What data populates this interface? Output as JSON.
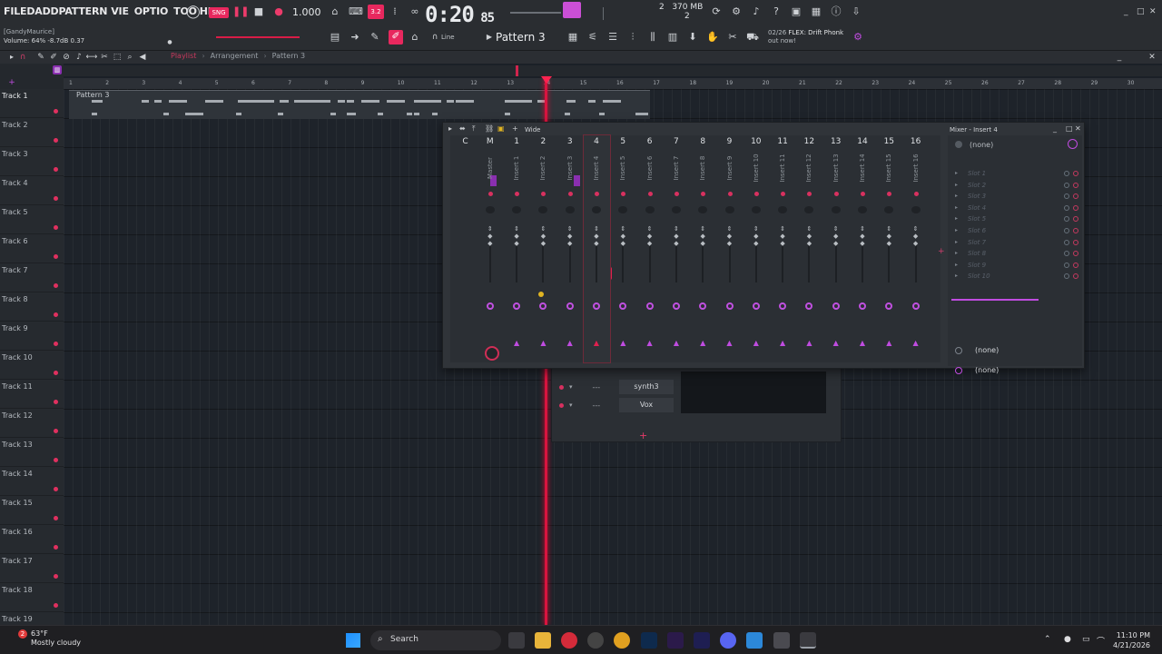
{
  "menu": [
    "FILE",
    "EDIT",
    "ADD",
    "PATTERNS",
    "VIEW",
    "OPTIONS",
    "TOOLS",
    "HELP"
  ],
  "menu_visible": [
    "FILE",
    "D",
    "ADD",
    "PATTERN",
    "VIE",
    "OPTIO",
    "TOO",
    "HEL"
  ],
  "hint": {
    "user": "[GandyMaurice]",
    "volume": "Volume: 64%  -8.7dB  0.37"
  },
  "transport": {
    "tempo": "1.000",
    "time_main": "0:20",
    "time_sub": "85",
    "pattern": "Pattern 3",
    "snap": "Line"
  },
  "memory": {
    "cpu": "2",
    "mem": "370 MB",
    "voices": "2"
  },
  "news": {
    "date": "02/26",
    "title": "FLEX: Drift Phonk",
    "sub": "out now!"
  },
  "playlist": {
    "breadcrumb": [
      "Playlist",
      "Arrangement",
      "Pattern 3"
    ],
    "clip_label": "Pattern 3",
    "ruler_bars": [
      "1",
      "2",
      "3",
      "4",
      "5",
      "6",
      "7",
      "8",
      "9",
      "10",
      "11",
      "12",
      "13",
      "14",
      "15",
      "16",
      "17",
      "18",
      "19",
      "20",
      "21",
      "22",
      "23",
      "24",
      "25",
      "26",
      "27",
      "28",
      "29",
      "30"
    ],
    "tracks": [
      "Track 1",
      "Track 2",
      "Track 3",
      "Track 4",
      "Track 5",
      "Track 6",
      "Track 7",
      "Track 8",
      "Track 9",
      "Track 10",
      "Track 11",
      "Track 12",
      "Track 13",
      "Track 14",
      "Track 15",
      "Track 16",
      "Track 17",
      "Track 18",
      "Track 19"
    ]
  },
  "channel_rack": {
    "channels": [
      "synth3",
      "Vox"
    ],
    "dash": "---"
  },
  "mixer": {
    "title": "Mixer - Insert 4",
    "view_mode": "Wide",
    "strip_numbers": [
      "C",
      "M",
      "1",
      "2",
      "3",
      "4",
      "5",
      "6",
      "7",
      "8",
      "9",
      "10",
      "11",
      "12",
      "13",
      "14",
      "15",
      "16"
    ],
    "strip_labels": [
      "",
      "Master",
      "Insert 1",
      "Insert 2",
      "Insert 3",
      "Insert 4",
      "Insert 5",
      "Insert 6",
      "Insert 7",
      "Insert 8",
      "Insert 9",
      "Insert 10",
      "Insert 11",
      "Insert 12",
      "Insert 13",
      "Insert 14",
      "Insert 15",
      "Insert 16"
    ],
    "routing": "(none)",
    "slots": [
      "Slot 1",
      "Slot 2",
      "Slot 3",
      "Slot 4",
      "Slot 5",
      "Slot 6",
      "Slot 7",
      "Slot 8",
      "Slot 9",
      "Slot 10"
    ],
    "input_none": "(none)",
    "output_none": "(none)"
  },
  "taskbar": {
    "weather_temp": "63°F",
    "weather_desc": "Mostly cloudy",
    "weather_badge": "2",
    "search": "Search",
    "time": "11:10 PM",
    "date": "4/21/2026"
  },
  "colors": {
    "accent": "#e8285e",
    "purple": "#c04ce0",
    "bg": "#1b2027"
  }
}
